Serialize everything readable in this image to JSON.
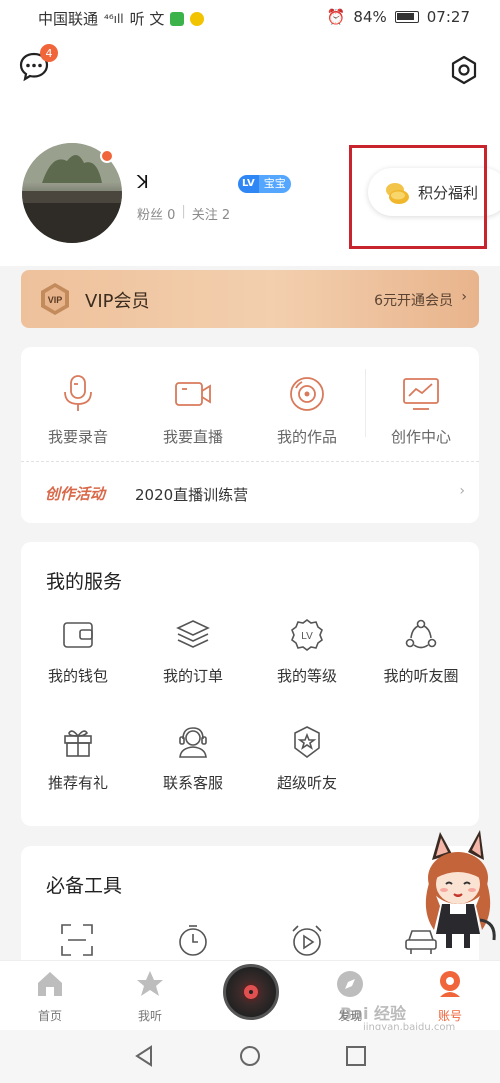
{
  "status_bar": {
    "carrier": "中国联通",
    "signal": "⁴⁶ıll",
    "apps": "听 文",
    "battery": "84%",
    "time": "07:27"
  },
  "header": {
    "message_badge": "4",
    "username": "ꓘ",
    "level_badge": "LV",
    "level_name": "宝宝",
    "fans": "粉丝 0",
    "following": "关注 2",
    "points_label": "积分福利"
  },
  "vip": {
    "icon_text": "VIP",
    "title": "VIP会员",
    "cta": "6元开通会员",
    "arrow": "›"
  },
  "create": {
    "items": [
      {
        "label": "我要录音",
        "icon": "microphone-icon"
      },
      {
        "label": "我要直播",
        "icon": "video-camera-icon"
      },
      {
        "label": "我的作品",
        "icon": "disc-icon"
      },
      {
        "label": "创作中心",
        "icon": "chart-monitor-icon"
      }
    ],
    "activity_title": "创作活动",
    "activity_text": "2020直播训练营",
    "activity_arrow": "›"
  },
  "services": {
    "title": "我的服务",
    "items": [
      {
        "label": "我的钱包",
        "icon": "wallet-icon"
      },
      {
        "label": "我的订单",
        "icon": "layers-icon"
      },
      {
        "label": "我的等级",
        "icon": "level-icon",
        "icon_text": "LV"
      },
      {
        "label": "我的听友圈",
        "icon": "friends-circle-icon"
      },
      {
        "label": "推荐有礼",
        "icon": "gift-icon"
      },
      {
        "label": "联系客服",
        "icon": "headset-icon"
      },
      {
        "label": "超级听友",
        "icon": "badge-star-icon"
      }
    ]
  },
  "tools": {
    "title": "必备工具",
    "items": [
      {
        "icon": "scan-icon"
      },
      {
        "icon": "timer-icon"
      },
      {
        "icon": "alarm-icon"
      },
      {
        "icon": "car-icon"
      }
    ]
  },
  "bottom_nav": {
    "items": [
      {
        "label": "首页",
        "icon": "home-icon"
      },
      {
        "label": "我听",
        "icon": "star-icon"
      },
      {
        "label": "",
        "icon": "now-playing-disc"
      },
      {
        "label": "发现",
        "icon": "compass-icon"
      },
      {
        "label": "账号",
        "icon": "account-icon",
        "active": true
      }
    ]
  },
  "colors": {
    "accent": "#f0653a",
    "create_icon": "#d97a5c",
    "vip_gold": "#eec19b",
    "level_blue": "#2f87f5",
    "highlight_box": "#c8242d"
  },
  "watermark": {
    "logo": "Bai 经验",
    "url": "jingyan.baidu.com"
  }
}
